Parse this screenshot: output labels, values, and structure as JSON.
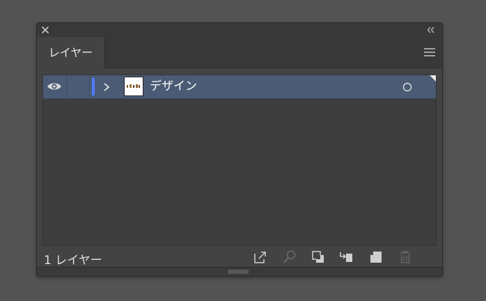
{
  "panel": {
    "tab_label": "レイヤー",
    "layer_count_label": "1 レイヤー"
  },
  "layers": [
    {
      "name": "デザイン",
      "color": "#4f7bff",
      "visible": true,
      "selected": true
    }
  ],
  "icons": {
    "close": "close-icon",
    "collapse": "double-chevron-left-icon",
    "menu": "hamburger-menu-icon",
    "eye": "eye-icon",
    "expand": "chevron-right-icon",
    "target": "target-circle-icon",
    "export": "export-icon",
    "locate": "magnifier-icon",
    "clipping_mask": "clipping-mask-icon",
    "sublayer": "new-sublayer-icon",
    "new_layer": "new-layer-icon",
    "delete": "trash-icon"
  },
  "colors": {
    "selection": "#4b5b75",
    "layer_color": "#4f7bff",
    "panel_bg": "#434343"
  }
}
